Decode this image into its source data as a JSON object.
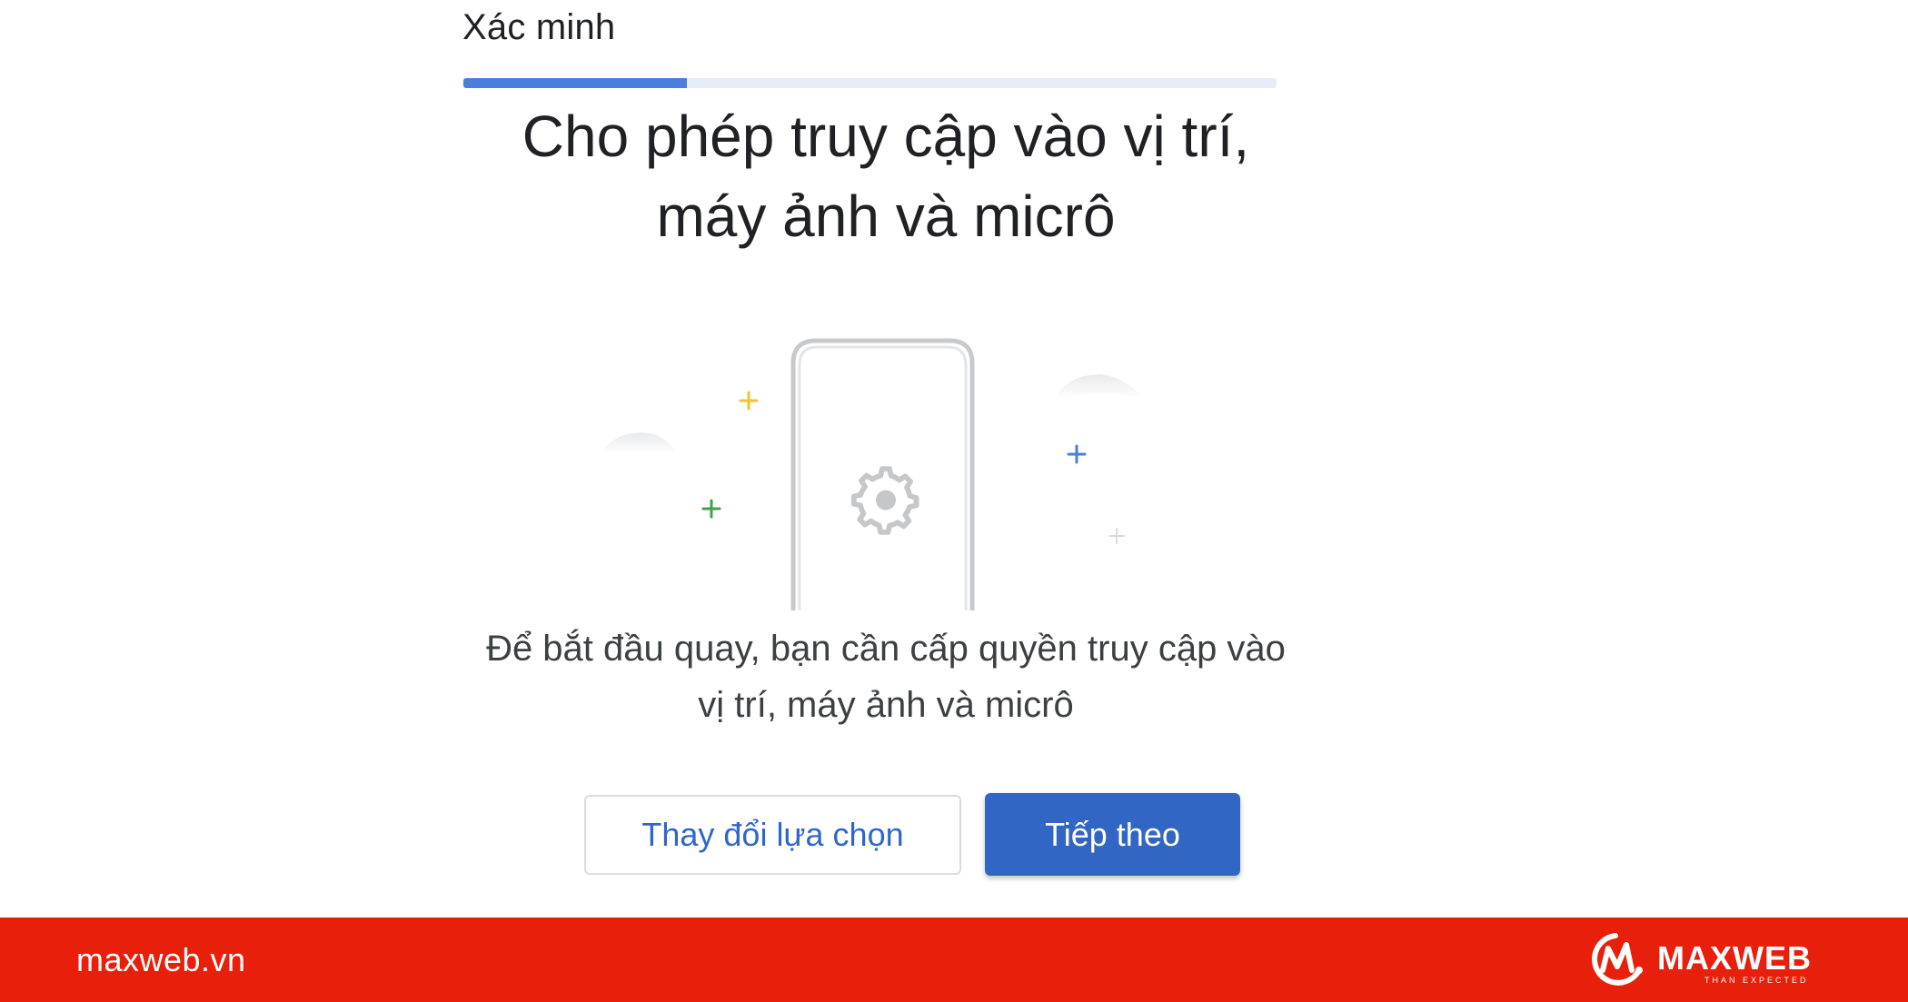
{
  "header": {
    "step_title": "Xác minh",
    "progress_fraction": 0.275
  },
  "main": {
    "headline_line1": "Cho phép truy cập vào vị trí,",
    "headline_line2": "máy ảnh và micrô",
    "description_line1": "Để bắt đầu quay, bạn cần cấp quyền truy cập vào",
    "description_line2": "vị trí, máy ảnh và micrô",
    "illustration_icon": "gear-icon"
  },
  "actions": {
    "secondary_label": "Thay đổi lựa chọn",
    "primary_label": "Tiếp theo"
  },
  "footer": {
    "site": "maxweb.vn",
    "brand": "MAXWEB",
    "tagline": "THAN EXPECTED"
  },
  "colors": {
    "accent_blue": "#3166c4",
    "progress_blue": "#4a7fd9",
    "footer_red": "#e81f0a"
  }
}
